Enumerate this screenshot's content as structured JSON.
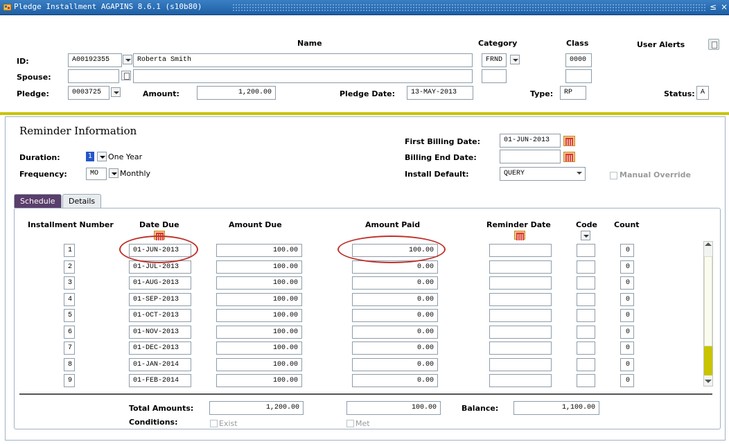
{
  "window": {
    "title": "Pledge Installment  AGAPINS  8.6.1  (s10b80)",
    "controls": [
      "≤",
      "×"
    ]
  },
  "header": {
    "name_col": "Name",
    "category_col": "Category",
    "class_col": "Class",
    "user_alerts": "User Alerts",
    "id_label": "ID:",
    "id_value": "A00192355",
    "name_value": "Roberta Smith",
    "category_value": "FRND",
    "class_value": "0000",
    "spouse_label": "Spouse:",
    "spouse_id": "",
    "spouse_name": "",
    "pledge_label": "Pledge:",
    "pledge_value": "0003725",
    "amount_label": "Amount:",
    "amount_value": "1,200.00",
    "pledge_date_label": "Pledge Date:",
    "pledge_date_value": "13-MAY-2013",
    "type_label": "Type:",
    "type_value": "RP",
    "status_label": "Status:",
    "status_value": "A"
  },
  "reminder": {
    "title": "Reminder Information",
    "duration_label": "Duration:",
    "duration_value": "1",
    "duration_desc": "One Year",
    "frequency_label": "Frequency:",
    "frequency_value": "MO",
    "frequency_desc": "Monthly",
    "first_billing_label": "First Billing Date:",
    "first_billing_value": "01-JUN-2013",
    "billing_end_label": "Billing End Date:",
    "billing_end_value": "",
    "install_default_label": "Install Default:",
    "install_default_value": "QUERY",
    "manual_override_label": "Manual Override"
  },
  "tabs": [
    {
      "label": "Schedule",
      "active": true
    },
    {
      "label": "Details",
      "active": false
    }
  ],
  "schedule": {
    "columns": {
      "installment_number": "Installment Number",
      "date_due": "Date Due",
      "amount_due": "Amount Due",
      "amount_paid": "Amount Paid",
      "reminder_date": "Reminder Date",
      "code": "Code",
      "count": "Count"
    },
    "rows": [
      {
        "num": "1",
        "date": "01-JUN-2013",
        "due": "100.00",
        "paid": "100.00",
        "reminder": "",
        "code": "",
        "count": "0"
      },
      {
        "num": "2",
        "date": "01-JUL-2013",
        "due": "100.00",
        "paid": "0.00",
        "reminder": "",
        "code": "",
        "count": "0"
      },
      {
        "num": "3",
        "date": "01-AUG-2013",
        "due": "100.00",
        "paid": "0.00",
        "reminder": "",
        "code": "",
        "count": "0"
      },
      {
        "num": "4",
        "date": "01-SEP-2013",
        "due": "100.00",
        "paid": "0.00",
        "reminder": "",
        "code": "",
        "count": "0"
      },
      {
        "num": "5",
        "date": "01-OCT-2013",
        "due": "100.00",
        "paid": "0.00",
        "reminder": "",
        "code": "",
        "count": "0"
      },
      {
        "num": "6",
        "date": "01-NOV-2013",
        "due": "100.00",
        "paid": "0.00",
        "reminder": "",
        "code": "",
        "count": "0"
      },
      {
        "num": "7",
        "date": "01-DEC-2013",
        "due": "100.00",
        "paid": "0.00",
        "reminder": "",
        "code": "",
        "count": "0"
      },
      {
        "num": "8",
        "date": "01-JAN-2014",
        "due": "100.00",
        "paid": "0.00",
        "reminder": "",
        "code": "",
        "count": "0"
      },
      {
        "num": "9",
        "date": "01-FEB-2014",
        "due": "100.00",
        "paid": "0.00",
        "reminder": "",
        "code": "",
        "count": "0"
      }
    ],
    "total_amounts_label": "Total Amounts:",
    "total_due": "1,200.00",
    "total_paid": "100.00",
    "balance_label": "Balance:",
    "balance_value": "1,100.00",
    "conditions_label": "Conditions:",
    "exist_label": "Exist",
    "met_label": "Met"
  },
  "colors": {
    "titlebar": "#1d5fa6",
    "divider": "#c8c400",
    "active_tab": "#5a3e6b",
    "highlight_oval": "#c0302a",
    "scroll_thumb": "#c8c400"
  }
}
